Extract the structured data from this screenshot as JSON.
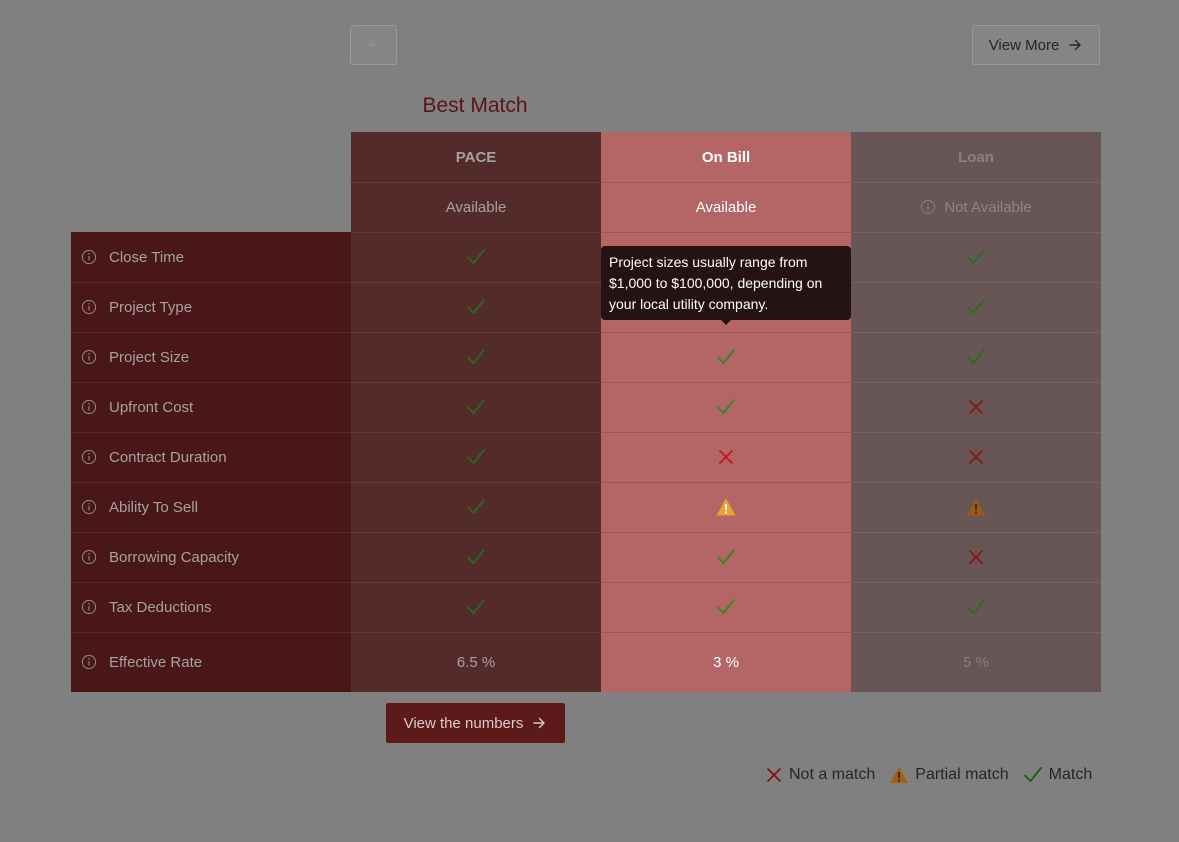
{
  "nav": {
    "view_more_label": "View More"
  },
  "best_match_label": "Best Match",
  "criteria": [
    {
      "label": "Close Time"
    },
    {
      "label": "Project Type"
    },
    {
      "label": "Project Size"
    },
    {
      "label": "Upfront Cost"
    },
    {
      "label": "Contract Duration"
    },
    {
      "label": "Ability To Sell"
    },
    {
      "label": "Borrowing Capacity"
    },
    {
      "label": "Tax Deductions"
    },
    {
      "label": "Effective Rate"
    }
  ],
  "plans": [
    {
      "name": "PACE",
      "availability": "Available",
      "rate": "6.5 %",
      "matches": [
        "match",
        "match",
        "match",
        "match",
        "match",
        "match",
        "match",
        "match"
      ]
    },
    {
      "name": "On Bill",
      "availability": "Available",
      "rate": "3 %",
      "matches": [
        "hidden",
        "hidden",
        "match",
        "match",
        "no",
        "partial",
        "match",
        "match"
      ]
    },
    {
      "name": "Loan",
      "availability": "Not Available",
      "rate": "5 %",
      "matches": [
        "match",
        "match",
        "match",
        "no",
        "no",
        "partial",
        "no",
        "match"
      ]
    }
  ],
  "tooltip": {
    "text": "Project sizes usually range from $1,000 to $100,000, depending on your local utility company."
  },
  "view_numbers_label": "View the numbers",
  "legend": {
    "not_match": "Not a match",
    "partial": "Partial match",
    "match": "Match"
  },
  "colors": {
    "match": "#2f7a1f",
    "no": "#b01515",
    "partial": "#e08a1e"
  }
}
